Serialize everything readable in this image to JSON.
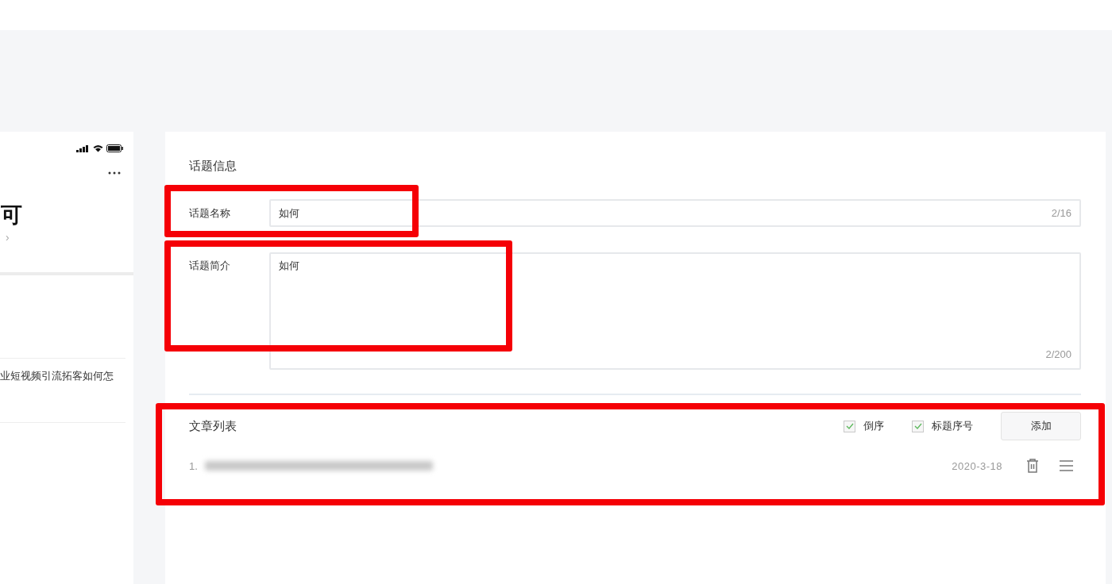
{
  "phone_preview": {
    "title": "可",
    "chevron": "›",
    "snippet": "业短视频引流拓客如何怎"
  },
  "topic_info": {
    "title": "话题信息",
    "fields": [
      {
        "kind": "input",
        "label": "话题名称",
        "value": "如何",
        "counter": "2/16",
        "highlighted": true
      },
      {
        "kind": "textarea",
        "label": "话题简介",
        "value": "如何",
        "counter": "2/200",
        "highlighted": true
      }
    ]
  },
  "article_list": {
    "title": "文章列表",
    "highlighted": true,
    "options": [
      {
        "label": "倒序",
        "checked": true
      },
      {
        "label": "标题序号",
        "checked": true
      }
    ],
    "add_button": "添加",
    "items": [
      {
        "index": "1.",
        "date": "2020-3-18"
      }
    ]
  }
}
